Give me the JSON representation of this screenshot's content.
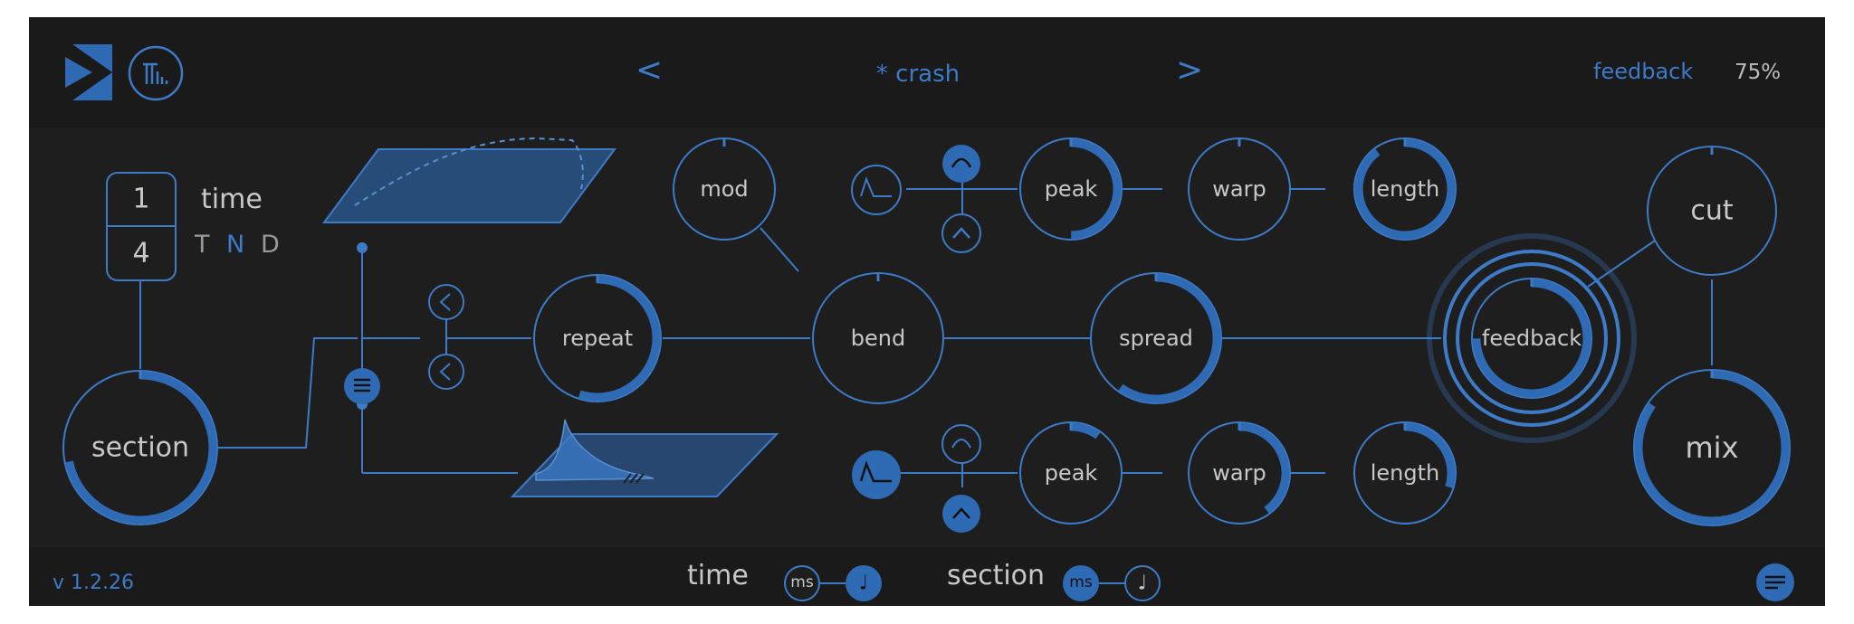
{
  "header": {
    "prev_label": "<",
    "next_label": ">",
    "preset_name": "* crash",
    "param_name": "feedback",
    "param_value": "75%"
  },
  "knobs": {
    "section": "section",
    "repeat": "repeat",
    "mod": "mod",
    "bend": "bend",
    "spread": "spread",
    "peak_top": "peak",
    "warp_top": "warp",
    "length_top": "length",
    "peak_bottom": "peak",
    "warp_bottom": "warp",
    "length_bottom": "length",
    "feedback": "feedback",
    "cut": "cut",
    "mix": "mix"
  },
  "time_division": {
    "numerator": "1",
    "denominator": "4",
    "label": "time",
    "modes": [
      "T",
      "N",
      "D"
    ],
    "active_mode": "N"
  },
  "footer": {
    "version": "v 1.2.26",
    "time_label": "time",
    "section_label": "section",
    "ms_label": "ms",
    "note_glyph": "♩"
  },
  "colors": {
    "accent": "#2f6ab4",
    "line": "#3d7ac7",
    "panel": "#1e1e1e",
    "bar": "#1a1a1a",
    "text": "#c8c8c8"
  },
  "icons": [
    "logo-icon",
    "tmi-icon",
    "lowpass-icon",
    "bell-icon",
    "highpass-icon",
    "reverse-arrow-icon",
    "menu-icon",
    "note-icon"
  ]
}
